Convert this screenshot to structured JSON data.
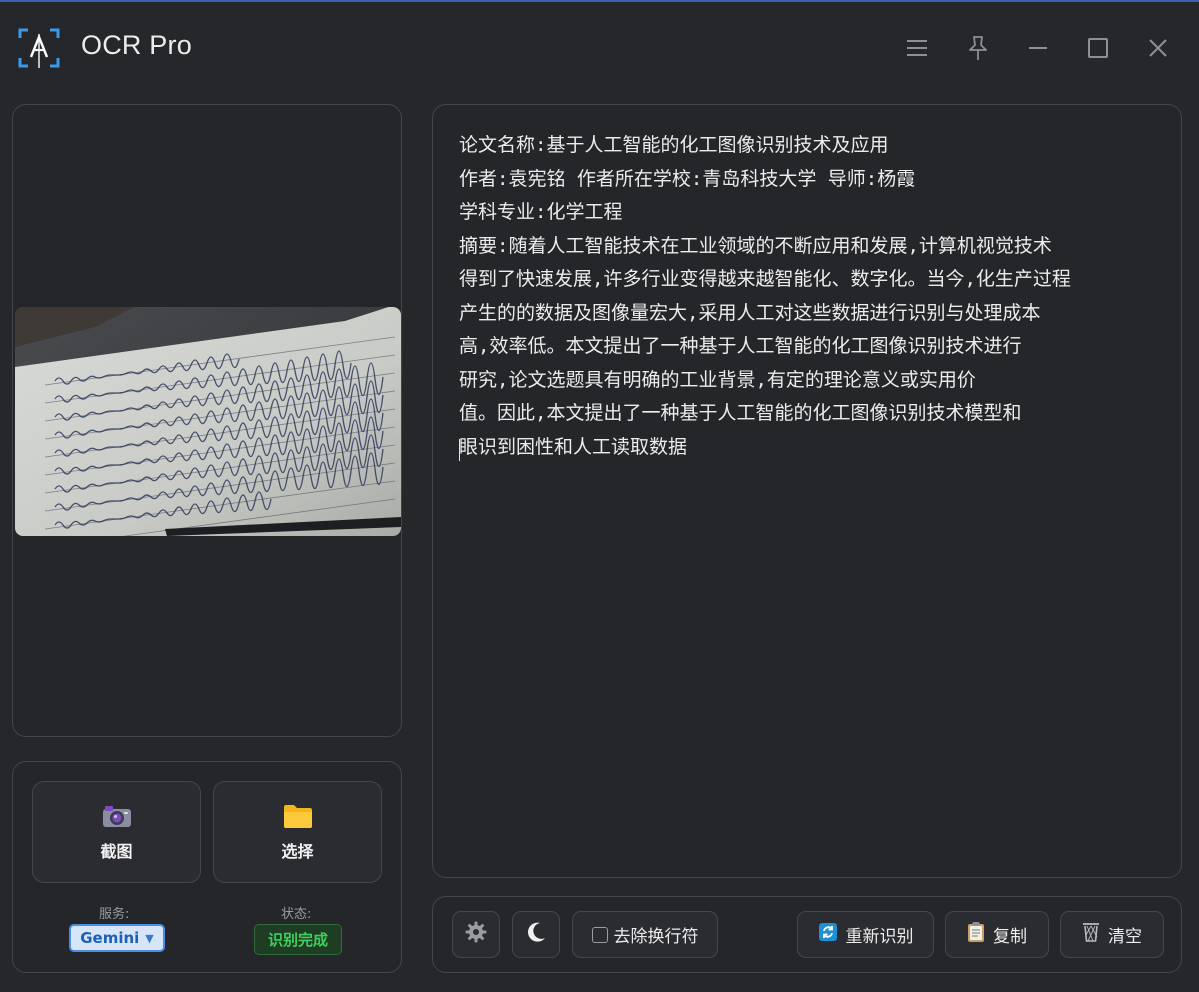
{
  "app": {
    "title": "OCR Pro",
    "accent_color": "#3a63b8"
  },
  "titlebar": {
    "icons": [
      "menu-icon",
      "pin-icon",
      "minimize-icon",
      "maximize-icon",
      "close-icon"
    ]
  },
  "preview": {
    "image_desc_icon": "photo-preview"
  },
  "actions": {
    "capture_label": "截图",
    "capture_icon": "camera-icon",
    "select_label": "选择",
    "select_icon": "folder-icon"
  },
  "service": {
    "label": "服务:",
    "value": "Gemini",
    "caret": "▼"
  },
  "status": {
    "label": "状态:",
    "value": "识别完成",
    "color": "#3fcf5a"
  },
  "ocr": {
    "lines": [
      "论文名称:基于人工智能的化工图像识别技术及应用",
      "作者:袁宪铭 作者所在学校:青岛科技大学 导师:杨霞",
      "学科专业:化学工程",
      "摘要:随着人工智能技术在工业领域的不断应用和发展,计算机视觉技术",
      "得到了快速发展,许多行业变得越来越智能化、数字化。当今,化生产过程",
      "产生的的数据及图像量宏大,采用人工对这些数据进行识别与处理成本",
      "高,效率低。本文提出了一种基于人工智能的化工图像识别技术进行",
      "研究,论文选题具有明确的工业背景,有定的理论意义或实用价",
      "值。因此,本文提出了一种基于人工智能的化工图像识别技术模型和",
      "眼识到困性和人工读取数据"
    ]
  },
  "toolbar": {
    "settings_icon": "gear-icon",
    "theme_icon": "moon-icon",
    "remove_newlines_label": "去除换行符",
    "remove_newlines_checked": false,
    "recognize_label": "重新识别",
    "recognize_icon": "refresh-icon",
    "copy_label": "复制",
    "copy_icon": "clipboard-icon",
    "clear_label": "清空",
    "clear_icon": "trash-icon"
  }
}
